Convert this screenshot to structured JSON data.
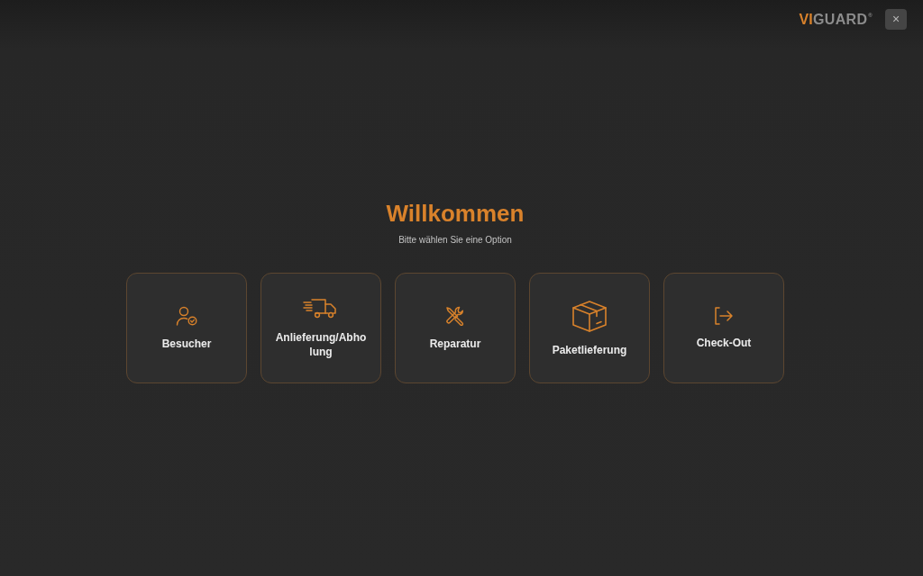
{
  "header": {
    "logo": {
      "accent": "VI",
      "text": "GUARD",
      "mark": "®"
    },
    "close_button": {
      "label": "×"
    }
  },
  "welcome": {
    "title": "Willkommen",
    "subtitle": "Bitte wählen Sie eine Option"
  },
  "options": [
    {
      "kind": "visitor",
      "label": "Besucher"
    },
    {
      "kind": "delivery",
      "label": "Anlieferung/Abholung"
    },
    {
      "kind": "repair",
      "label": "Reparatur"
    },
    {
      "kind": "parcel",
      "label": "Paketlieferung"
    },
    {
      "kind": "checkout",
      "label": "Check-Out"
    }
  ]
}
